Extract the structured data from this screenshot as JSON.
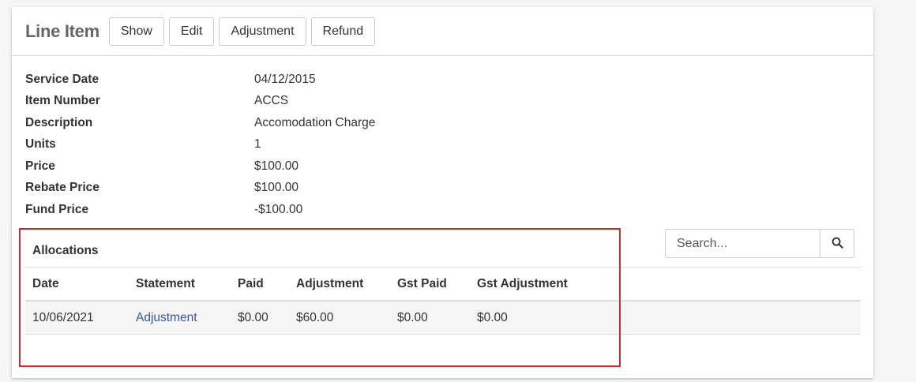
{
  "header": {
    "title": "Line Item",
    "buttons": [
      "Show",
      "Edit",
      "Adjustment",
      "Refund"
    ]
  },
  "details": [
    {
      "label": "Service Date",
      "value": "04/12/2015"
    },
    {
      "label": "Item Number",
      "value": "ACCS"
    },
    {
      "label": "Description",
      "value": "Accomodation Charge"
    },
    {
      "label": "Units",
      "value": "1"
    },
    {
      "label": "Price",
      "value": "$100.00"
    },
    {
      "label": "Rebate Price",
      "value": "$100.00"
    },
    {
      "label": "Fund Price",
      "value": "-$100.00"
    }
  ],
  "search": {
    "placeholder": "Search...",
    "icon": "search-icon"
  },
  "allocations": {
    "title": "Allocations",
    "columns": [
      "Date",
      "Statement",
      "Paid",
      "Adjustment",
      "Gst Paid",
      "Gst Adjustment"
    ],
    "rows": [
      {
        "date": "10/06/2021",
        "statement": "Adjustment",
        "paid": "$0.00",
        "adjustment": "$60.00",
        "gst_paid": "$0.00",
        "gst_adjustment": "$0.00"
      }
    ]
  },
  "colors": {
    "highlight": "#d9262c",
    "link": "#3a53a4",
    "title": "#666666"
  }
}
